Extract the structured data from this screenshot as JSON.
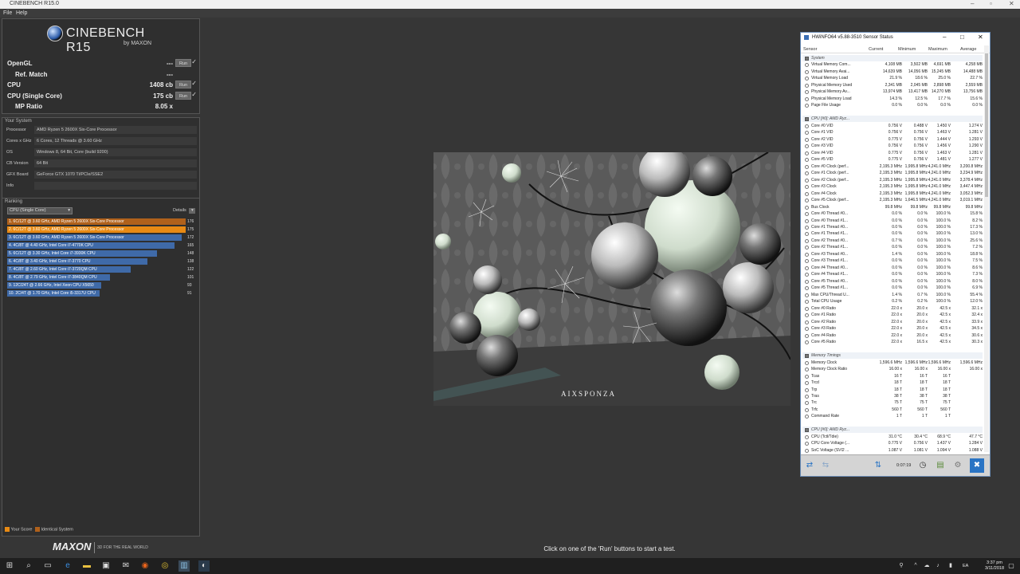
{
  "window": {
    "title": "CINEBENCH R15.0"
  },
  "menu": {
    "file": "File",
    "help": "Help"
  },
  "logo": {
    "name": "CINEBENCH R15",
    "by": "by MAXON"
  },
  "scores": [
    {
      "label": "OpenGL",
      "value": "---",
      "run": "Run",
      "indent": false
    },
    {
      "label": "Ref. Match",
      "value": "---",
      "run": "",
      "indent": true
    },
    {
      "label": "CPU",
      "value": "1408 cb",
      "run": "Run",
      "indent": false
    },
    {
      "label": "CPU (Single Core)",
      "value": "175 cb",
      "run": "Run",
      "indent": false
    },
    {
      "label": "MP Ratio",
      "value": "8.05 x",
      "run": "",
      "indent": true
    }
  ],
  "your_system": {
    "title": "Your System",
    "rows": [
      {
        "k": "Processor",
        "v": "AMD Ryzen 5 2600X Six-Core Processor"
      },
      {
        "k": "Cores x GHz",
        "v": "6 Cores, 12 Threads @ 3.60 GHz"
      },
      {
        "k": "OS",
        "v": "Windows 8, 64 Bit, Core (build 9200)"
      },
      {
        "k": "CB Version",
        "v": "64 Bit"
      },
      {
        "k": "GFX Board",
        "v": "GeForce GTX 1070 Ti/PCIe/SSE2"
      },
      {
        "k": "Info",
        "v": ""
      }
    ]
  },
  "ranking": {
    "title": "Ranking",
    "selector": "CPU (Single Core)",
    "details": "Details",
    "items": [
      {
        "label": "1. 6C/12T @ 3.60 GHz, AMD Ryzen 5 2600X Six-Core Processor",
        "score": "176",
        "frac": 1.0,
        "color": "#b0611b"
      },
      {
        "label": "2. 6C/12T @ 3.60 GHz, AMD Ryzen 5 2600X Six-Core Processor",
        "score": "175",
        "frac": 1.0,
        "color": "#e88a14"
      },
      {
        "label": "3. 6C/12T @ 3.60 GHz, AMD Ryzen 5 2600X Six-Core Processor",
        "score": "172",
        "frac": 0.977,
        "color": "#3f6aa8"
      },
      {
        "label": "4. 4C/8T @ 4.40 GHz, Intel Core i7-4770K CPU",
        "score": "165",
        "frac": 0.9375,
        "color": "#3f6aa8"
      },
      {
        "label": "5. 6C/12T @ 3.30 GHz,  Intel Core i7-3930K CPU",
        "score": "148",
        "frac": 0.84,
        "color": "#3f6aa8"
      },
      {
        "label": "6. 4C/8T @ 3.40 GHz,  Intel Core i7-3770 CPU",
        "score": "138",
        "frac": 0.784,
        "color": "#3f6aa8"
      },
      {
        "label": "7. 4C/8T @ 2.60 GHz, Intel Core i7-3720QM CPU",
        "score": "122",
        "frac": 0.693,
        "color": "#3f6aa8"
      },
      {
        "label": "8. 4C/8T @ 2.79 GHz,  Intel Core i7-3840QM CPU",
        "score": "101",
        "frac": 0.574,
        "color": "#3f6aa8"
      },
      {
        "label": "9. 12C/24T @ 2.66 GHz, Intel Xeon CPU X5650",
        "score": "93",
        "frac": 0.528,
        "color": "#3f6aa8"
      },
      {
        "label": "10. 2C/4T @ 1.70 GHz,  Intel Core i5-3317U CPU",
        "score": "91",
        "frac": 0.517,
        "color": "#3f6aa8"
      }
    ]
  },
  "legend": {
    "your_score": "Your Score",
    "identical": "Identical System"
  },
  "footer": {
    "brand": "MAXON",
    "slogan": "3D FOR THE REAL WORLD",
    "status": "Click on one of the 'Run' buttons to start a test."
  },
  "render": {
    "watermark": "AIXSPONZA"
  },
  "hwinfo": {
    "title": "HWiNFO64 v5.88-3510 Sensor Status",
    "columns": {
      "sensor": "Sensor",
      "current": "Current",
      "minimum": "Minimum",
      "maximum": "Maximum",
      "average": "Average"
    },
    "timer": "0:07:19",
    "rows": [
      {
        "g": "System"
      },
      {
        "n": "Virtual Memory Com...",
        "c": "4,108 MB",
        "mi": "3,502 MB",
        "ma": "4,691 MB",
        "av": "4,258 MB"
      },
      {
        "n": "Virtual Memory Avai...",
        "c": "14,639 MB",
        "mi": "14,056 MB",
        "ma": "15,245 MB",
        "av": "14,488 MB"
      },
      {
        "n": "Virtual Memory Load",
        "c": "21.9 %",
        "mi": "18.6 %",
        "ma": "25.0 %",
        "av": "22.7 %"
      },
      {
        "n": "Physical Memory Used",
        "c": "2,341 MB",
        "mi": "2,045 MB",
        "ma": "2,898 MB",
        "av": "2,559 MB"
      },
      {
        "n": "Physical Memory Av...",
        "c": "13,974 MB",
        "mi": "13,417 MB",
        "ma": "14,270 MB",
        "av": "13,756 MB"
      },
      {
        "n": "Physical Memory Load",
        "c": "14.3 %",
        "mi": "12.5 %",
        "ma": "17.7 %",
        "av": "15.6 %"
      },
      {
        "n": "Page File Usage",
        "c": "0.0 %",
        "mi": "0.0 %",
        "ma": "0.0 %",
        "av": "0.0 %"
      },
      {
        "blank": true
      },
      {
        "g": "CPU [#0]: AMD Ryz..."
      },
      {
        "n": "Core #0 VID",
        "c": "0.756 V",
        "mi": "0.488 V",
        "ma": "1.450 V",
        "av": "1.274 V"
      },
      {
        "n": "Core #1 VID",
        "c": "0.756 V",
        "mi": "0.756 V",
        "ma": "1.463 V",
        "av": "1.281 V"
      },
      {
        "n": "Core #2 VID",
        "c": "0.775 V",
        "mi": "0.756 V",
        "ma": "1.444 V",
        "av": "1.293 V"
      },
      {
        "n": "Core #3 VID",
        "c": "0.756 V",
        "mi": "0.756 V",
        "ma": "1.456 V",
        "av": "1.290 V"
      },
      {
        "n": "Core #4 VID",
        "c": "0.775 V",
        "mi": "0.756 V",
        "ma": "1.463 V",
        "av": "1.281 V"
      },
      {
        "n": "Core #5 VID",
        "c": "0.775 V",
        "mi": "0.756 V",
        "ma": "1.481 V",
        "av": "1.277 V"
      },
      {
        "n": "Core #0 Clock (perf...",
        "c": "2,195.3 MHz",
        "mi": "1,995.8 MHz",
        "ma": "4,241.0 MHz",
        "av": "3,200.8 MHz"
      },
      {
        "n": "Core #1 Clock (perf...",
        "c": "2,195.3 MHz",
        "mi": "1,995.8 MHz",
        "ma": "4,241.0 MHz",
        "av": "3,234.9 MHz"
      },
      {
        "n": "Core #2 Clock (perf...",
        "c": "2,195.3 MHz",
        "mi": "1,995.8 MHz",
        "ma": "4,241.0 MHz",
        "av": "3,378.4 MHz"
      },
      {
        "n": "Core #3 Clock",
        "c": "2,195.3 MHz",
        "mi": "1,995.8 MHz",
        "ma": "4,241.0 MHz",
        "av": "3,447.4 MHz"
      },
      {
        "n": "Core #4 Clock",
        "c": "2,195.3 MHz",
        "mi": "1,995.8 MHz",
        "ma": "4,241.0 MHz",
        "av": "3,052.3 MHz"
      },
      {
        "n": "Core #5 Clock (perf...",
        "c": "2,195.3 MHz",
        "mi": "1,646.5 MHz",
        "ma": "4,241.0 MHz",
        "av": "3,019.1 MHz"
      },
      {
        "n": "Bus Clock",
        "c": "99.8 MHz",
        "mi": "99.8 MHz",
        "ma": "99.8 MHz",
        "av": "99.8 MHz"
      },
      {
        "n": "Core #0 Thread #0...",
        "c": "0.0 %",
        "mi": "0.0 %",
        "ma": "100.0 %",
        "av": "15.8 %"
      },
      {
        "n": "Core #0 Thread #1...",
        "c": "0.0 %",
        "mi": "0.0 %",
        "ma": "100.0 %",
        "av": "8.2 %"
      },
      {
        "n": "Core #1 Thread #0...",
        "c": "0.0 %",
        "mi": "0.0 %",
        "ma": "100.0 %",
        "av": "17.3 %"
      },
      {
        "n": "Core #1 Thread #1...",
        "c": "0.0 %",
        "mi": "0.0 %",
        "ma": "100.0 %",
        "av": "13.0 %"
      },
      {
        "n": "Core #2 Thread #0...",
        "c": "0.7 %",
        "mi": "0.0 %",
        "ma": "100.0 %",
        "av": "25.6 %"
      },
      {
        "n": "Core #2 Thread #1...",
        "c": "0.0 %",
        "mi": "0.0 %",
        "ma": "100.0 %",
        "av": "7.2 %"
      },
      {
        "n": "Core #3 Thread #0...",
        "c": "1.4 %",
        "mi": "0.0 %",
        "ma": "100.0 %",
        "av": "18.8 %"
      },
      {
        "n": "Core #3 Thread #1...",
        "c": "0.0 %",
        "mi": "0.0 %",
        "ma": "100.0 %",
        "av": "7.5 %"
      },
      {
        "n": "Core #4 Thread #0...",
        "c": "0.0 %",
        "mi": "0.0 %",
        "ma": "100.0 %",
        "av": "8.6 %"
      },
      {
        "n": "Core #4 Thread #1...",
        "c": "0.0 %",
        "mi": "0.0 %",
        "ma": "100.0 %",
        "av": "7.3 %"
      },
      {
        "n": "Core #5 Thread #0...",
        "c": "0.0 %",
        "mi": "0.0 %",
        "ma": "100.0 %",
        "av": "8.0 %"
      },
      {
        "n": "Core #5 Thread #1...",
        "c": "0.0 %",
        "mi": "0.0 %",
        "ma": "100.0 %",
        "av": "6.9 %"
      },
      {
        "n": "Max CPU/Thread U...",
        "c": "1.4 %",
        "mi": "0.7 %",
        "ma": "100.0 %",
        "av": "55.4 %"
      },
      {
        "n": "Total CPU Usage",
        "c": "0.2 %",
        "mi": "0.2 %",
        "ma": "100.0 %",
        "av": "12.0 %"
      },
      {
        "n": "Core #0 Ratio",
        "c": "22.0 x",
        "mi": "20.0 x",
        "ma": "42.5 x",
        "av": "32.1 x"
      },
      {
        "n": "Core #1 Ratio",
        "c": "22.0 x",
        "mi": "20.0 x",
        "ma": "42.5 x",
        "av": "32.4 x"
      },
      {
        "n": "Core #2 Ratio",
        "c": "22.0 x",
        "mi": "20.0 x",
        "ma": "42.5 x",
        "av": "33.9 x"
      },
      {
        "n": "Core #3 Ratio",
        "c": "22.0 x",
        "mi": "20.0 x",
        "ma": "42.5 x",
        "av": "34.5 x"
      },
      {
        "n": "Core #4 Ratio",
        "c": "22.0 x",
        "mi": "20.0 x",
        "ma": "42.5 x",
        "av": "30.6 x"
      },
      {
        "n": "Core #5 Ratio",
        "c": "22.0 x",
        "mi": "16.5 x",
        "ma": "42.5 x",
        "av": "30.3 x"
      },
      {
        "blank": true
      },
      {
        "g": "Memory Timings"
      },
      {
        "n": "Memory Clock",
        "c": "1,596.6 MHz",
        "mi": "1,596.6 MHz",
        "ma": "1,596.6 MHz",
        "av": "1,596.6 MHz"
      },
      {
        "n": "Memory Clock Ratio",
        "c": "16.00 x",
        "mi": "16.00 x",
        "ma": "16.00 x",
        "av": "16.00 x"
      },
      {
        "n": "Tcas",
        "c": "16 T",
        "mi": "16 T",
        "ma": "16 T",
        "av": ""
      },
      {
        "n": "Trcd",
        "c": "18 T",
        "mi": "18 T",
        "ma": "18 T",
        "av": ""
      },
      {
        "n": "Trp",
        "c": "18 T",
        "mi": "18 T",
        "ma": "18 T",
        "av": ""
      },
      {
        "n": "Tras",
        "c": "38 T",
        "mi": "38 T",
        "ma": "38 T",
        "av": ""
      },
      {
        "n": "Trc",
        "c": "75 T",
        "mi": "75 T",
        "ma": "75 T",
        "av": ""
      },
      {
        "n": "Trfc",
        "c": "560 T",
        "mi": "560 T",
        "ma": "560 T",
        "av": ""
      },
      {
        "n": "Command Rate",
        "c": "1 T",
        "mi": "1 T",
        "ma": "1 T",
        "av": ""
      },
      {
        "blank": true
      },
      {
        "g": "CPU [#0]: AMD Ryz..."
      },
      {
        "n": "CPU (Tctl/Tdie)",
        "c": "31.0 °C",
        "mi": "30.4 °C",
        "ma": "68.9 °C",
        "av": "47.7 °C"
      },
      {
        "n": "CPU Core Voltage (...",
        "c": "0.775 V",
        "mi": "0.756 V",
        "ma": "1.437 V",
        "av": "1.284 V"
      },
      {
        "n": "SoC Voltage (SVI2 ...",
        "c": "1.087 V",
        "mi": "1.081 V",
        "ma": "1.094 V",
        "av": "1.088 V"
      }
    ]
  },
  "taskbar": {
    "time": "3:37 pm",
    "date": "3/11/2018",
    "lang": "EA"
  }
}
